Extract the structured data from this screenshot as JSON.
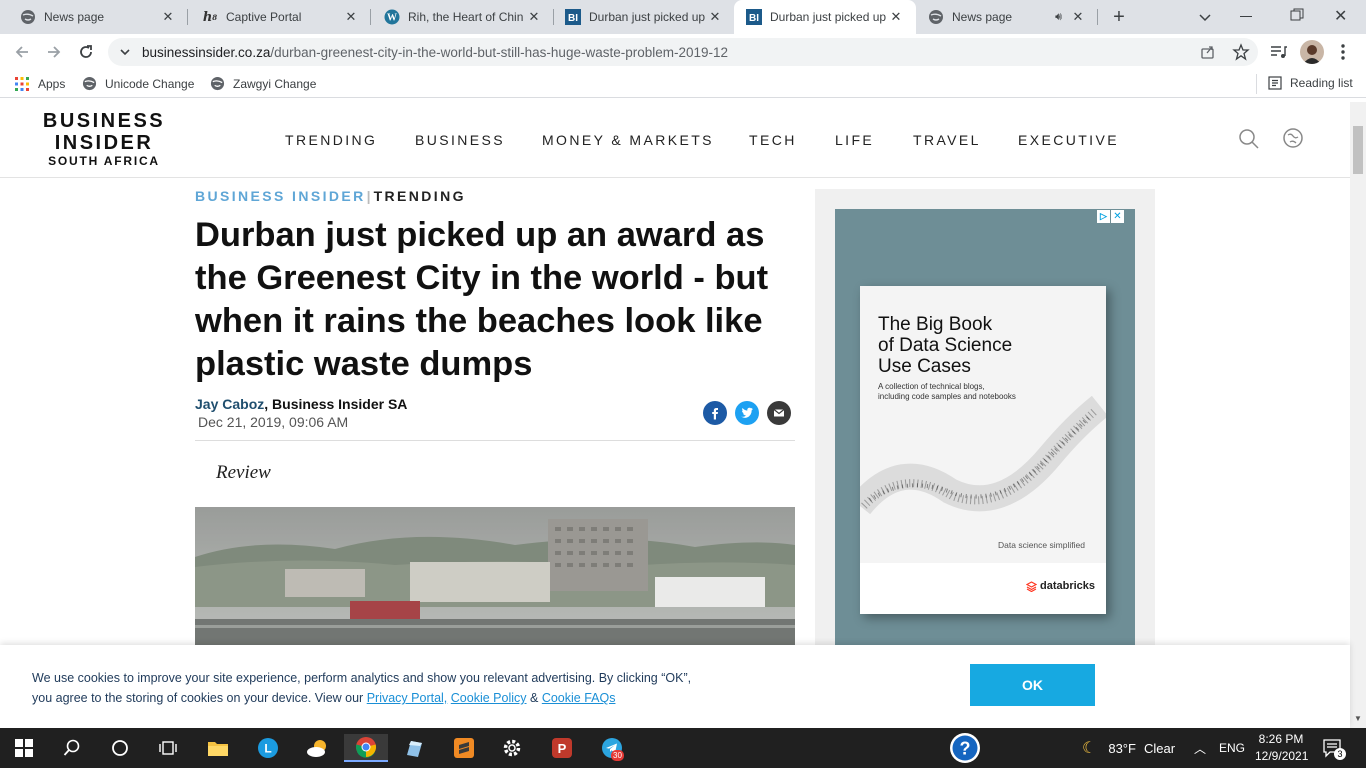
{
  "browser": {
    "tabs": [
      {
        "title": "News page",
        "icon": "globe-icon"
      },
      {
        "title": "Captive Portal",
        "icon": "h8-icon"
      },
      {
        "title": "Rih, the Heart of Chin",
        "icon": "wordpress-icon"
      },
      {
        "title": "Durban just picked up",
        "icon": "bi-icon"
      },
      {
        "title": "Durban just picked up",
        "icon": "bi-icon"
      },
      {
        "title": "News page",
        "icon": "globe-icon"
      }
    ],
    "new_tab": "+",
    "url_domain": "businessinsider.co.za",
    "url_path": "/durban-greenest-city-in-the-world-but-still-has-huge-waste-problem-2019-12",
    "bookmarks": [
      {
        "label": "Apps"
      },
      {
        "label": "Unicode Change"
      },
      {
        "label": "Zawgyi Change"
      }
    ],
    "reading_list": "Reading list"
  },
  "site": {
    "logo_line1": "BUSINESS",
    "logo_line2": "INSIDER",
    "logo_line3": "SOUTH AFRICA",
    "nav": [
      "TRENDING",
      "BUSINESS",
      "MONEY & MARKETS",
      "TECH",
      "LIFE",
      "TRAVEL",
      "EXECUTIVE"
    ]
  },
  "article": {
    "section_brand": "BUSINESS INSIDER",
    "section_sep": "|",
    "section_name": "TRENDING",
    "headline_lines": [
      "Durban just picked up an award as",
      "the Greenest City in the world - but",
      "when it rains the beaches look like",
      "plastic waste dumps"
    ],
    "author": "Jay Caboz",
    "publication": ", Business Insider SA",
    "date": "Dec 21, 2019, 09:06 AM",
    "review_label": "Review"
  },
  "ad": {
    "title_lines": [
      "The Big Book",
      "of Data Science",
      "Use Cases"
    ],
    "subtitle_lines": [
      "A collection of technical blogs,",
      "including code samples and notebooks"
    ],
    "tagline": "Data science simplified",
    "brand": "databricks"
  },
  "cookie": {
    "line1": "We use cookies to improve your site experience, perform analytics and show you relevant advertising. By clicking “OK”,",
    "line2_prefix": "you agree to the storing of cookies on your device. View our",
    "link1": "Privacy Portal,",
    "link2": "Cookie Policy",
    "amp": "&",
    "link3": "Cookie FAQs",
    "ok_label": "OK"
  },
  "taskbar": {
    "temperature": "83°F",
    "weather": "Clear",
    "lang": "ENG",
    "time": "8:26 PM",
    "date": "12/9/2021",
    "notification_count": "3",
    "telegram_badge": "30"
  },
  "colors": {
    "brand_blue": "#5fa6d6",
    "cookie_ok": "#17a9e1",
    "facebook": "#1d5aa5",
    "twitter": "#1da1f2",
    "mail": "#3a3a3a"
  }
}
